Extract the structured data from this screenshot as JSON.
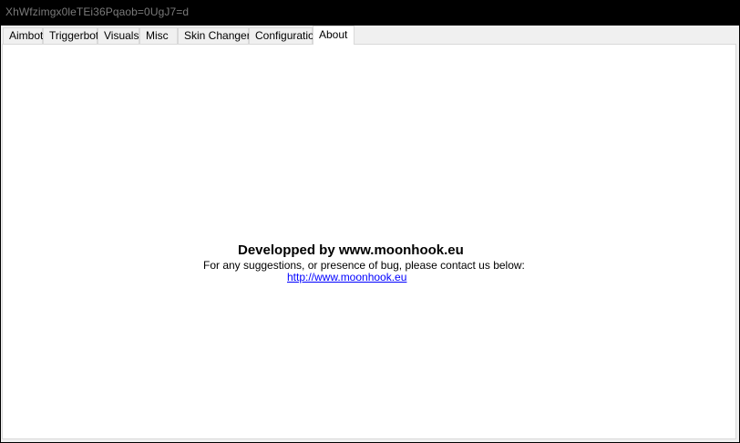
{
  "window": {
    "title": "XhWfzimgx0leTEi36Pqaob=0UgJ7=d"
  },
  "tabs": [
    {
      "label": "Aimbot",
      "active": false
    },
    {
      "label": "Triggerbot",
      "active": false
    },
    {
      "label": "Visuals",
      "active": false
    },
    {
      "label": "Misc",
      "active": false
    },
    {
      "label": "Skin Changer",
      "active": false
    },
    {
      "label": "Configuration",
      "active": false
    },
    {
      "label": "About",
      "active": true
    }
  ],
  "about": {
    "heading": "Developped by www.moonhook.eu",
    "subtext": "For any suggestions, or presence of bug, please contact us below:",
    "link": "http://www.moonhook.eu"
  },
  "colors": {
    "titlebar": "#000000",
    "title_text": "#7a7a7a",
    "panel_background": "#ffffff",
    "tab_background": "#f0f0f0",
    "link": "#0000ff"
  }
}
